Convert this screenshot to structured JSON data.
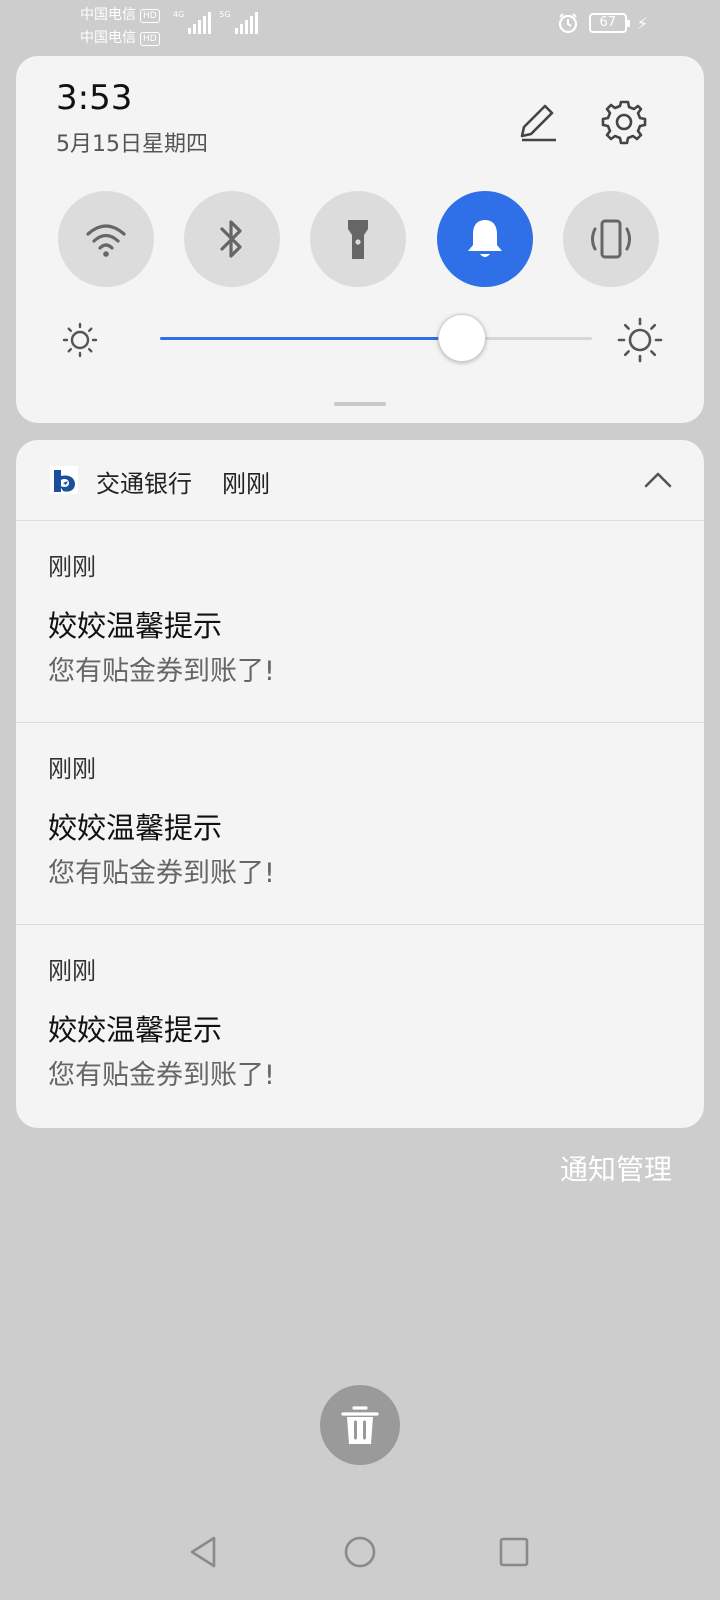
{
  "status_bar": {
    "carrier_1": "中国电信",
    "carrier_2": "中国电信",
    "hd_badge": "HD",
    "network_1": "4G",
    "network_2": "5G",
    "battery_level": "67"
  },
  "quick_settings": {
    "time": "3:53",
    "date": "5月15日星期四",
    "toggles": [
      {
        "name": "wifi",
        "active": false
      },
      {
        "name": "bluetooth",
        "active": false
      },
      {
        "name": "flashlight",
        "active": false
      },
      {
        "name": "sound",
        "active": true
      },
      {
        "name": "vibrate",
        "active": false
      }
    ],
    "brightness_fraction": 0.7,
    "accent_color": "#2f6fe8"
  },
  "notification_group": {
    "app_name": "交通银行",
    "time": "刚刚",
    "items": [
      {
        "time": "刚刚",
        "title": "姣姣温馨提示",
        "body": "您有贴金券到账了!"
      },
      {
        "time": "刚刚",
        "title": "姣姣温馨提示",
        "body": "您有贴金券到账了!"
      },
      {
        "time": "刚刚",
        "title": "姣姣温馨提示",
        "body": "您有贴金券到账了!"
      }
    ]
  },
  "notification_manage_label": "通知管理"
}
